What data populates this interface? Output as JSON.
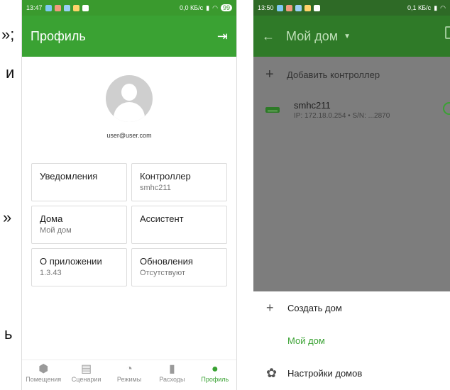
{
  "page_fragments": {
    "f1": "»;",
    "f2": "и",
    "f3": "»",
    "f4": "ь"
  },
  "phone1": {
    "status": {
      "time": "13:47",
      "net": "0,0 КБ/с",
      "battery": "99"
    },
    "appbar": {
      "title": "Профиль",
      "exit_icon": "exit-icon"
    },
    "email": "user@user.com",
    "cards": [
      {
        "title": "Уведомления",
        "subtitle": ""
      },
      {
        "title": "Контроллер",
        "subtitle": "smhc211"
      },
      {
        "title": "Дома",
        "subtitle": "Мой дом"
      },
      {
        "title": "Ассистент",
        "subtitle": ""
      },
      {
        "title": "О приложении",
        "subtitle": "1.3.43"
      },
      {
        "title": "Обновления",
        "subtitle": "Отсутствуют"
      }
    ],
    "nav": [
      {
        "label": "Помещения",
        "icon": "rooms-icon"
      },
      {
        "label": "Сценарии",
        "icon": "scenarios-icon"
      },
      {
        "label": "Режимы",
        "icon": "modes-icon"
      },
      {
        "label": "Расходы",
        "icon": "expenses-icon"
      },
      {
        "label": "Профиль",
        "icon": "profile-icon"
      }
    ],
    "active_nav": "Профиль",
    "accent": "#3aa233"
  },
  "phone2": {
    "status": {
      "time": "13:50",
      "net": "0,1 КБ/с"
    },
    "appbar": {
      "title": "Мой дом"
    },
    "add_controller": "Добавить контроллер",
    "device": {
      "name": "smhc211",
      "info": "IP: 172.18.0.254 • S/N: ...2870"
    },
    "sheet": {
      "create_home": "Создать дом",
      "selected_home": "Мой дом",
      "home_settings": "Настройки домов"
    }
  }
}
